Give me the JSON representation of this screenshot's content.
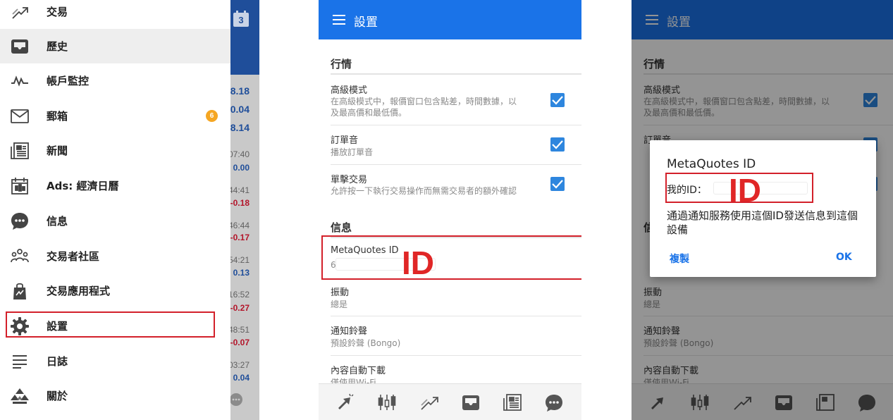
{
  "drawer": {
    "items": [
      {
        "label": "交易",
        "icon": "trade-icon"
      },
      {
        "label": "歷史",
        "icon": "history-inbox-icon"
      },
      {
        "label": "帳戶監控",
        "icon": "account-monitor-icon"
      },
      {
        "label": "郵箱",
        "icon": "mail-icon",
        "badge": "6"
      },
      {
        "label": "新聞",
        "icon": "news-icon"
      },
      {
        "label": "Ads: 經濟日曆",
        "icon": "calendar-icon"
      },
      {
        "label": "信息",
        "icon": "chat-icon"
      },
      {
        "label": "交易者社區",
        "icon": "community-icon"
      },
      {
        "label": "交易應用程式",
        "icon": "app-bag-icon"
      },
      {
        "label": "設置",
        "icon": "gear-icon"
      },
      {
        "label": "日誌",
        "icon": "journal-icon"
      },
      {
        "label": "關於",
        "icon": "about-icon"
      }
    ],
    "selected_index": 1,
    "highlighted_index": 9
  },
  "background_app": {
    "calendar_day": "3",
    "quotes": [
      {
        "value": "8.18"
      },
      {
        "value": "0.04"
      },
      {
        "value": "8.14"
      },
      {
        "time": "07:40",
        "change": "0.00",
        "dir": "pos"
      },
      {
        "time": "44:41",
        "change": "-0.18",
        "dir": "neg"
      },
      {
        "time": "46:44",
        "change": "-0.17",
        "dir": "neg"
      },
      {
        "time": "54:21",
        "change": "0.13",
        "dir": "pos"
      },
      {
        "time": "16:52",
        "change": "-0.27",
        "dir": "neg"
      },
      {
        "time": "48:51",
        "change": "-0.07",
        "dir": "neg"
      },
      {
        "time": "03:27",
        "change": "0.04",
        "dir": "pos"
      }
    ]
  },
  "settings": {
    "title": "設置",
    "section_quotes": "行情",
    "advanced_mode": {
      "title": "高級模式",
      "desc_line1": "在高級模式中，報價窗口包含點差，時間數據，以",
      "desc_line2": "及最高價和最低價。",
      "checked": true
    },
    "order_sound": {
      "title": "訂單音",
      "desc": "播放訂單音",
      "checked": true
    },
    "one_click": {
      "title": "單擊交易",
      "desc": "允許按一下執行交易操作而無需交易者的額外確認",
      "checked": true
    },
    "section_messages": "信息",
    "metaquotes_id": {
      "title": "MetaQuotes ID",
      "value_prefix": "6"
    },
    "vibration": {
      "title": "振動",
      "value": "總是"
    },
    "ringtone": {
      "title": "通知鈴聲",
      "value": "預設鈴聲 (Bongo)"
    },
    "auto_download": {
      "title": "內容自動下載",
      "value": "僅使用Wi-Fi"
    }
  },
  "settings_dim": {
    "title": "設置",
    "section_quotes": "行情",
    "advanced_title": "高級模式",
    "advanced_desc_line1": "在高級模式中，報價窗口包含點差，時間數據，以",
    "advanced_desc_line2": "及最高價和最低價。",
    "order_sound_title": "訂單音",
    "section_messages": "信",
    "vibration": {
      "title": "振動",
      "value": "總是"
    },
    "ringtone": {
      "title": "通知鈴聲",
      "value": "預設鈴聲 (Bongo)"
    },
    "auto_download": {
      "title": "內容自動下載",
      "value": "僅使用Wi-Fi"
    }
  },
  "dialog": {
    "title": "MetaQuotes ID",
    "id_label": "我的ID：",
    "body": "通過通知服務使用這個ID發送信息到這個設備",
    "copy_button": "複製",
    "ok_button": "OK"
  },
  "annotation": {
    "marker": "ID"
  },
  "bottom_nav": [
    "quotes-icon",
    "chart-icon",
    "trade-icon",
    "history-icon",
    "news-icon",
    "chat-icon"
  ],
  "colors": {
    "accent": "#1a73e8",
    "highlight": "#d3202a",
    "badge": "#f5a623",
    "checkbox": "#2e86de"
  }
}
